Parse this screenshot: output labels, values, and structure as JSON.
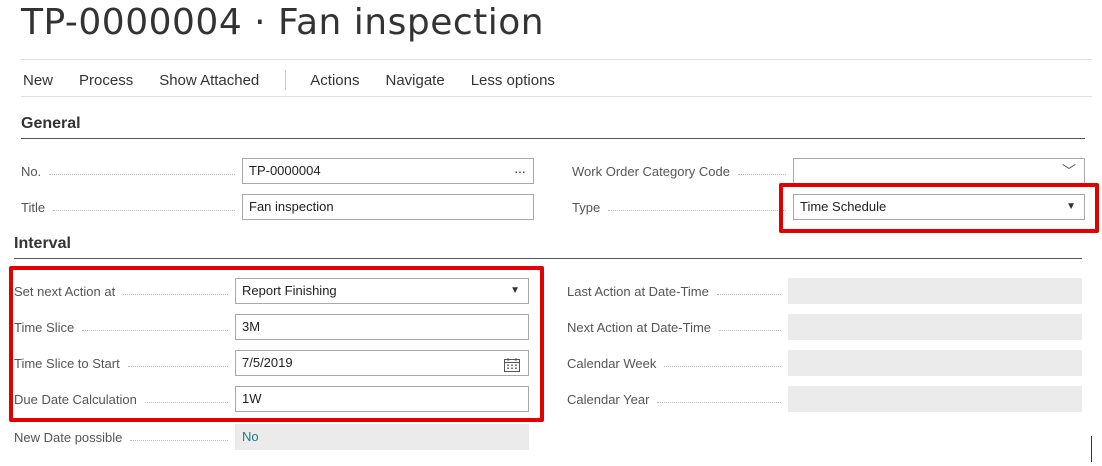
{
  "page": {
    "title": "TP-0000004 · Fan inspection"
  },
  "actions": [
    "New",
    "Process",
    "Show Attached",
    "Actions",
    "Navigate",
    "Less options"
  ],
  "general": {
    "heading": "General",
    "no_label": "No.",
    "no_value": "TP-0000004",
    "no_lookup": "···",
    "title_label": "Title",
    "title_value": "Fan inspection",
    "category_label": "Work Order Category Code",
    "category_value": "",
    "category_chevron": "﹀",
    "type_label": "Type",
    "type_value": "Time Schedule",
    "type_arrow": "▼"
  },
  "interval": {
    "heading": "Interval",
    "set_next_label": "Set next Action at",
    "set_next_value": "Report Finishing",
    "set_next_arrow": "▼",
    "time_slice_label": "Time Slice",
    "time_slice_value": "3M",
    "time_slice_start_label": "Time Slice to Start",
    "time_slice_start_value": "7/5/2019",
    "due_date_label": "Due Date Calculation",
    "due_date_value": "1W",
    "new_date_label": "New Date possible",
    "new_date_value": "No",
    "last_action_label": "Last Action at Date-Time",
    "last_action_value": "",
    "next_action_label": "Next Action at Date-Time",
    "next_action_value": "",
    "calendar_week_label": "Calendar Week",
    "calendar_week_value": "",
    "calendar_year_label": "Calendar Year",
    "calendar_year_value": ""
  },
  "highlight_color": "#e00000"
}
